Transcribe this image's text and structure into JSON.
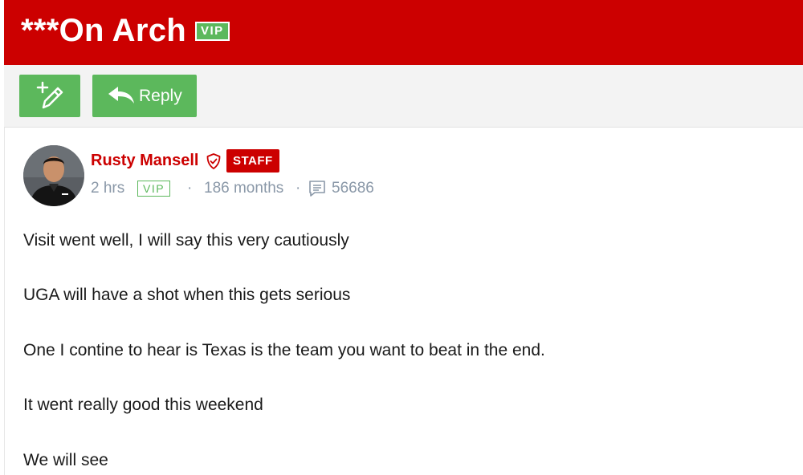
{
  "header": {
    "title": "***On Arch",
    "badge": "VIP",
    "color": "#cc0000"
  },
  "toolbar": {
    "reply_label": "Reply",
    "accent": "#5cb85c"
  },
  "post": {
    "author": "Rusty Mansell",
    "staff_badge": "STAFF",
    "time": "2 hrs",
    "vip_badge": "VIP",
    "membership": "186 months",
    "post_count": "56686",
    "paragraphs": [
      "Visit went well, I will say this very cautiously",
      "UGA will have a shot when this gets serious",
      "One I contine to hear is Texas is the team you want to beat in the end.",
      "It went really good this weekend",
      "We will see"
    ]
  },
  "icons": [
    "new-post-pencil-icon",
    "reply-arrow-icon",
    "shield-icon",
    "comment-icon"
  ]
}
